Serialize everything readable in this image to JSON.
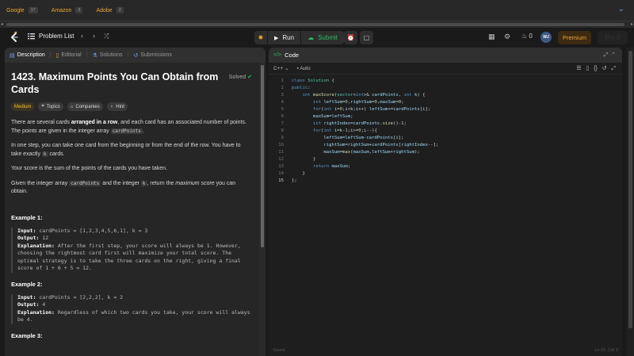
{
  "companies": [
    {
      "name": "Google",
      "count": "17"
    },
    {
      "name": "Amazon",
      "count": "3"
    },
    {
      "name": "Adobe",
      "count": "2"
    }
  ],
  "nav": {
    "problem_list": "Problem List",
    "run": "Run",
    "submit": "Submit",
    "streak": "0",
    "avatar": "WJ",
    "premium": "Premium",
    "ghost": "Pro 0"
  },
  "tabs": {
    "description": "Description",
    "editorial": "Editorial",
    "solutions": "Solutions",
    "submissions": "Submissions"
  },
  "problem": {
    "title": "1423. Maximum Points You Can Obtain from Cards",
    "status": "Solved",
    "difficulty": "Medium",
    "topics": "Topics",
    "companies": "Companies",
    "hint": "Hint",
    "p1a": "There are several cards ",
    "p1b": "arranged in a row",
    "p1c": ", and each card has an associated number of points. The points are given in the integer array ",
    "p1d": "cardPoints",
    "p1e": ".",
    "p2a": "In one step, you can take one card from the beginning or from the end of the row. You have to take exactly ",
    "p2b": "k",
    "p2c": " cards.",
    "p3": "Your score is the sum of the points of the cards you have taken.",
    "p4a": "Given the integer array ",
    "p4b": "cardPoints",
    "p4c": " and the integer ",
    "p4d": "k",
    "p4e": ", return the ",
    "p4f": "maximum score",
    "p4g": " you can obtain."
  },
  "examples": [
    {
      "heading": "Example 1:",
      "input_label": "Input:",
      "input": " cardPoints = [1,2,3,4,5,6,1], k = 3",
      "output_label": "Output:",
      "output": " 12",
      "expl_label": "Explanation:",
      "expl": " After the first step, your score will always be 1. However, choosing the rightmost card first will maximize your total score. The optimal strategy is to take the three cards on the right, giving a final score of 1 + 6 + 5 = 12."
    },
    {
      "heading": "Example 2:",
      "input_label": "Input:",
      "input": " cardPoints = [2,2,2], k = 2",
      "output_label": "Output:",
      "output": " 4",
      "expl_label": "Explanation:",
      "expl": " Regardless of which two cards you take, your score will always be 4."
    },
    {
      "heading": "Example 3:"
    }
  ],
  "code_panel": {
    "title": "Code",
    "language": "C++",
    "mode": "Auto",
    "status_left": "Saved",
    "status_right": "Ln 15, Col 3"
  },
  "code_lines": [
    "class Solution {",
    "public:",
    "    int maxScore(vector<int>& cardPoints, int k) {",
    "        int leftSum=0,rightSum=0,maxSum=0;",
    "        for(int i=0;i<k;i++) leftSum+=cardPoints[i];",
    "        maxSum=leftSum;",
    "        int rightIndex=cardPoints.size()-1;",
    "        for(int i=k-1;i>=0;i--){",
    "            leftSum=leftSum-cardPoints[i];",
    "            rightSum=rightSum+cardPoints[rightIndex--];",
    "            maxSum=max(maxSum,leftSum+rightSum);",
    "        }",
    "        return maxSum;",
    "    }",
    "};"
  ]
}
